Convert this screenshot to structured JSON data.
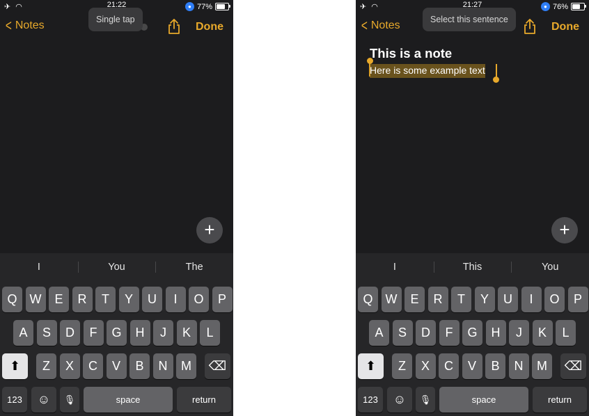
{
  "left": {
    "status": {
      "time": "21:22",
      "battery": "77%",
      "battery_level": 0.77
    },
    "nav": {
      "back_label": "Notes",
      "done_label": "Done"
    },
    "tooltip": "Single tap",
    "note": {
      "title": "",
      "body": ""
    },
    "fab_label": "+",
    "suggestions": [
      "I",
      "You",
      "The"
    ]
  },
  "right": {
    "status": {
      "time": "21:27",
      "battery": "76%",
      "battery_level": 0.76
    },
    "nav": {
      "back_label": "Notes",
      "done_label": "Done"
    },
    "tooltip": "Select this sentence",
    "note": {
      "title": "This is a note",
      "body": "Here is some example text"
    },
    "fab_label": "+",
    "suggestions": [
      "I",
      "This",
      "You"
    ]
  },
  "keyboard": {
    "row1": [
      "Q",
      "W",
      "E",
      "R",
      "T",
      "Y",
      "U",
      "I",
      "O",
      "P"
    ],
    "row2": [
      "A",
      "S",
      "D",
      "F",
      "G",
      "H",
      "J",
      "K",
      "L"
    ],
    "row3": [
      "Z",
      "X",
      "C",
      "V",
      "B",
      "N",
      "M"
    ],
    "numbers_label": "123",
    "space_label": "space",
    "return_label": "return"
  },
  "icons": {
    "back": "chevron-left-icon",
    "share": "share-icon",
    "collaborate": "add-people-icon",
    "shift": "shift-icon",
    "delete": "delete-icon",
    "emoji": "emoji-icon",
    "mic": "mic-icon",
    "airplane": "airplane-icon",
    "wifi": "wifi-icon"
  },
  "colors": {
    "accent": "#e8a92b",
    "background": "#1c1c1e",
    "keyboard": "#262628",
    "key": "#636366"
  }
}
